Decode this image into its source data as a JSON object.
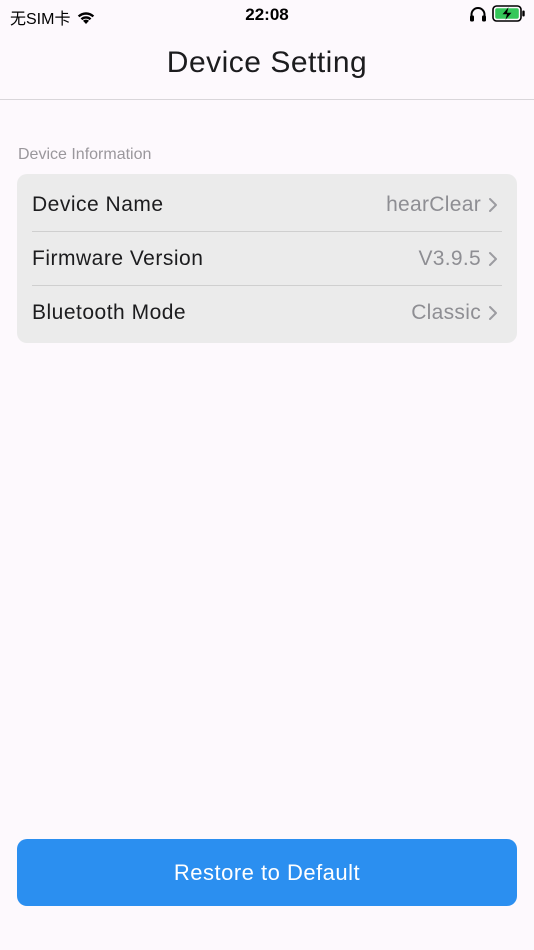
{
  "status_bar": {
    "carrier": "无SIM卡",
    "time": "22:08",
    "wifi_icon": "wifi-icon",
    "headphones_icon": "headphones-icon",
    "battery_icon": "battery-charging-icon",
    "battery_color": "#34c759"
  },
  "nav": {
    "title": "Device Setting"
  },
  "device_info": {
    "header": "Device Information",
    "rows": [
      {
        "label": "Device Name",
        "value": "hearClear"
      },
      {
        "label": "Firmware Version",
        "value": "V3.9.5"
      },
      {
        "label": "Bluetooth Mode",
        "value": "Classic"
      }
    ]
  },
  "actions": {
    "restore_label": "Restore to Default",
    "accent_color": "#2b8ff0"
  }
}
